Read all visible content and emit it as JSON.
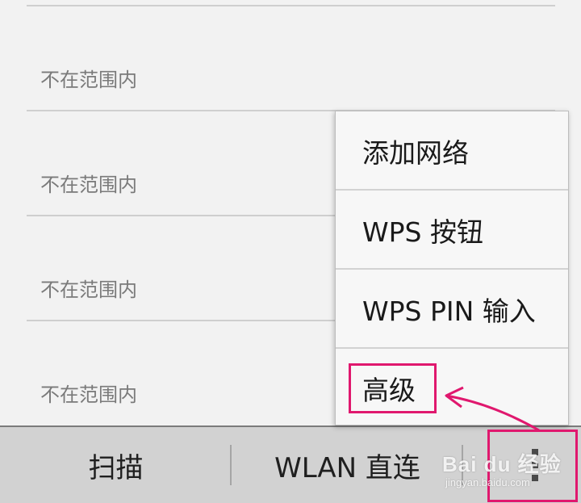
{
  "networks": [
    {
      "status": "不在范围内"
    },
    {
      "status": "不在范围内"
    },
    {
      "status": "不在范围内"
    },
    {
      "status": "不在范围内"
    }
  ],
  "menu": {
    "items": [
      {
        "label": "添加网络"
      },
      {
        "label": "WPS 按钮"
      },
      {
        "label": "WPS PIN 输入"
      },
      {
        "label": "高级"
      }
    ],
    "highlighted_item": "高级"
  },
  "bottom_bar": {
    "scan_label": "扫描",
    "wifi_direct_label": "WLAN 直连",
    "overflow_icon": "more-vert-icon"
  },
  "annotation": {
    "color": "#e0186e"
  },
  "watermark": {
    "main": "Bai du 经验",
    "sub": "jingyan.baidu.com"
  }
}
